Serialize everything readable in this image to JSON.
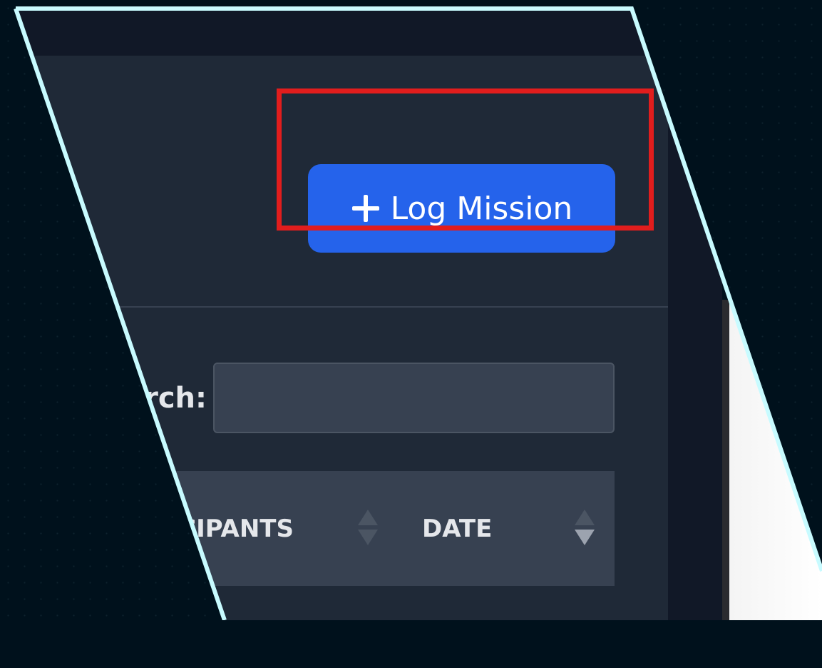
{
  "toolbar": {
    "log_mission_label": "Log Mission",
    "plus_icon": "plus-icon"
  },
  "search": {
    "label": "Search:",
    "value": "",
    "placeholder": ""
  },
  "table": {
    "columns": [
      {
        "label": "PARTICIPANTS",
        "sort_icon": "sort-icon"
      },
      {
        "label": "DATE",
        "sort_icon": "sort-icon"
      }
    ]
  },
  "colors": {
    "accent": "#2563eb",
    "highlight": "#e11d1d",
    "frame": "#c8fbff",
    "background": "#00111c",
    "panel": "#1f2937"
  }
}
